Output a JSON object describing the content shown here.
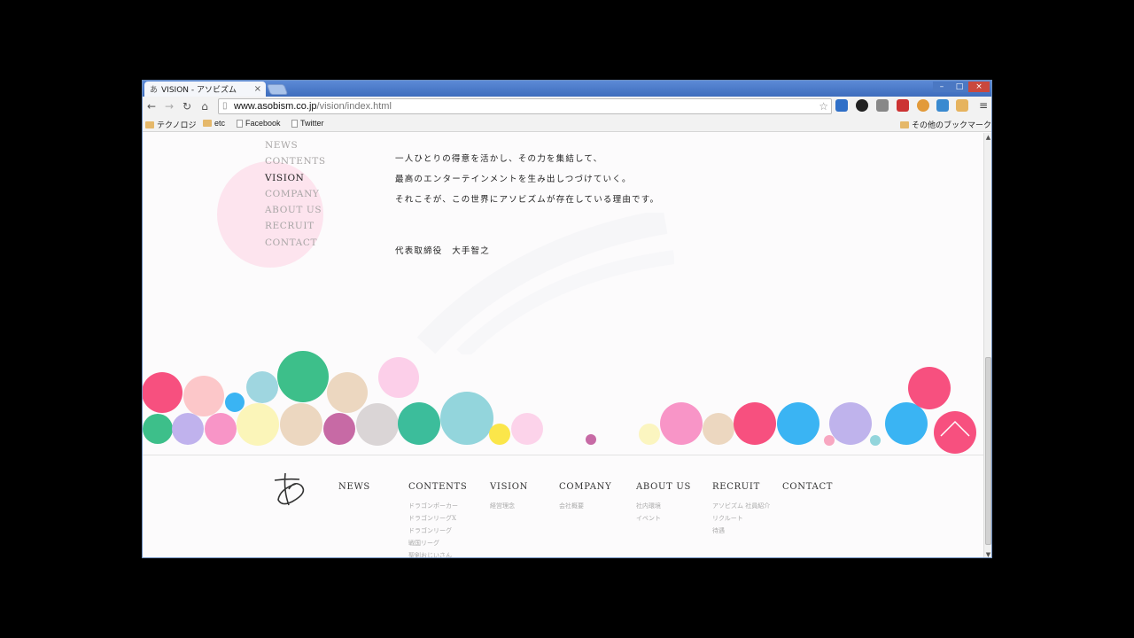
{
  "browser": {
    "tab_title": "VISION - アソビズム",
    "tab_favicon": "あ",
    "url_host": "www.asobism.co.jp",
    "url_path": "/vision/index.html",
    "bookmarks": [
      {
        "label": "テクノロジ",
        "icon": "folder-icon"
      },
      {
        "label": "etc",
        "icon": "folder-icon"
      },
      {
        "label": "Facebook",
        "icon": "page-icon"
      },
      {
        "label": "Twitter",
        "icon": "page-icon"
      }
    ],
    "other_bookmarks": "その他のブックマーク"
  },
  "sidenav": {
    "items": [
      "NEWS",
      "CONTENTS",
      "VISION",
      "COMPANY",
      "ABOUT US",
      "RECRUIT",
      "CONTACT"
    ],
    "active": "VISION"
  },
  "message": {
    "lines": [
      "一人ひとりの得意を活かし、その力を集結して、",
      "最高のエンターテインメントを生み出しつづけていく。",
      "それこそが、この世界にアソビズムが存在している理由です。"
    ],
    "signature": "代表取締役　大手智之"
  },
  "footer": {
    "columns": [
      {
        "head": "NEWS",
        "subs": []
      },
      {
        "head": "CONTENTS",
        "subs": [
          "ドラゴンポーカー",
          "ドラゴンリーグX",
          "ドラゴンリーグ",
          "戦国リーグ",
          "聖剣おじいさん"
        ]
      },
      {
        "head": "VISION",
        "subs": [
          "経営理念"
        ]
      },
      {
        "head": "COMPANY",
        "subs": [
          "会社概要"
        ]
      },
      {
        "head": "ABOUT US",
        "subs": [
          "社内環境",
          "イベント"
        ]
      },
      {
        "head": "RECRUIT",
        "subs": [
          "アソビズム 社員紹介",
          "リクルート",
          "待遇"
        ]
      },
      {
        "head": "CONTACT",
        "subs": []
      }
    ]
  },
  "colors": {
    "bubble_pink": "#f7507f",
    "bubble_green": "#3dbf8a",
    "bubble_blue": "#3ab4f3",
    "bubble_lavender": "#bfb3ec",
    "bubble_beige": "#ecd7c0",
    "bubble_teal": "#93d5dc"
  }
}
